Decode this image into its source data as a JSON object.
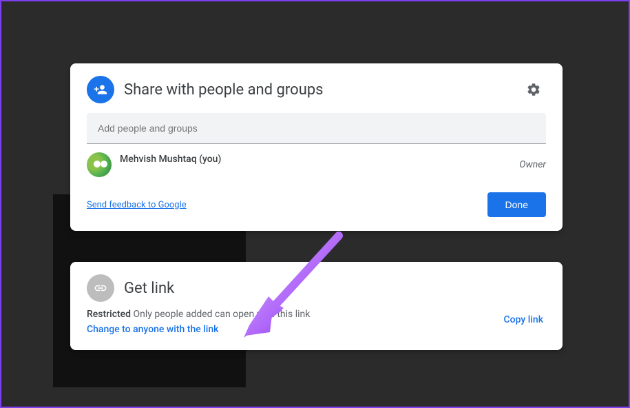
{
  "share": {
    "title": "Share with people and groups",
    "input_placeholder": "Add people and groups",
    "person_name": "Mehvish Mushtaq (you)",
    "person_role": "Owner",
    "feedback": "Send feedback to Google",
    "done": "Done"
  },
  "link": {
    "title": "Get link",
    "restricted_bold": "Restricted",
    "restricted_rest": " Only people added can open with this link",
    "change": "Change to anyone with the link",
    "copy": "Copy link"
  },
  "colors": {
    "primary": "#1a73e8",
    "arrow": "#b769ff"
  }
}
